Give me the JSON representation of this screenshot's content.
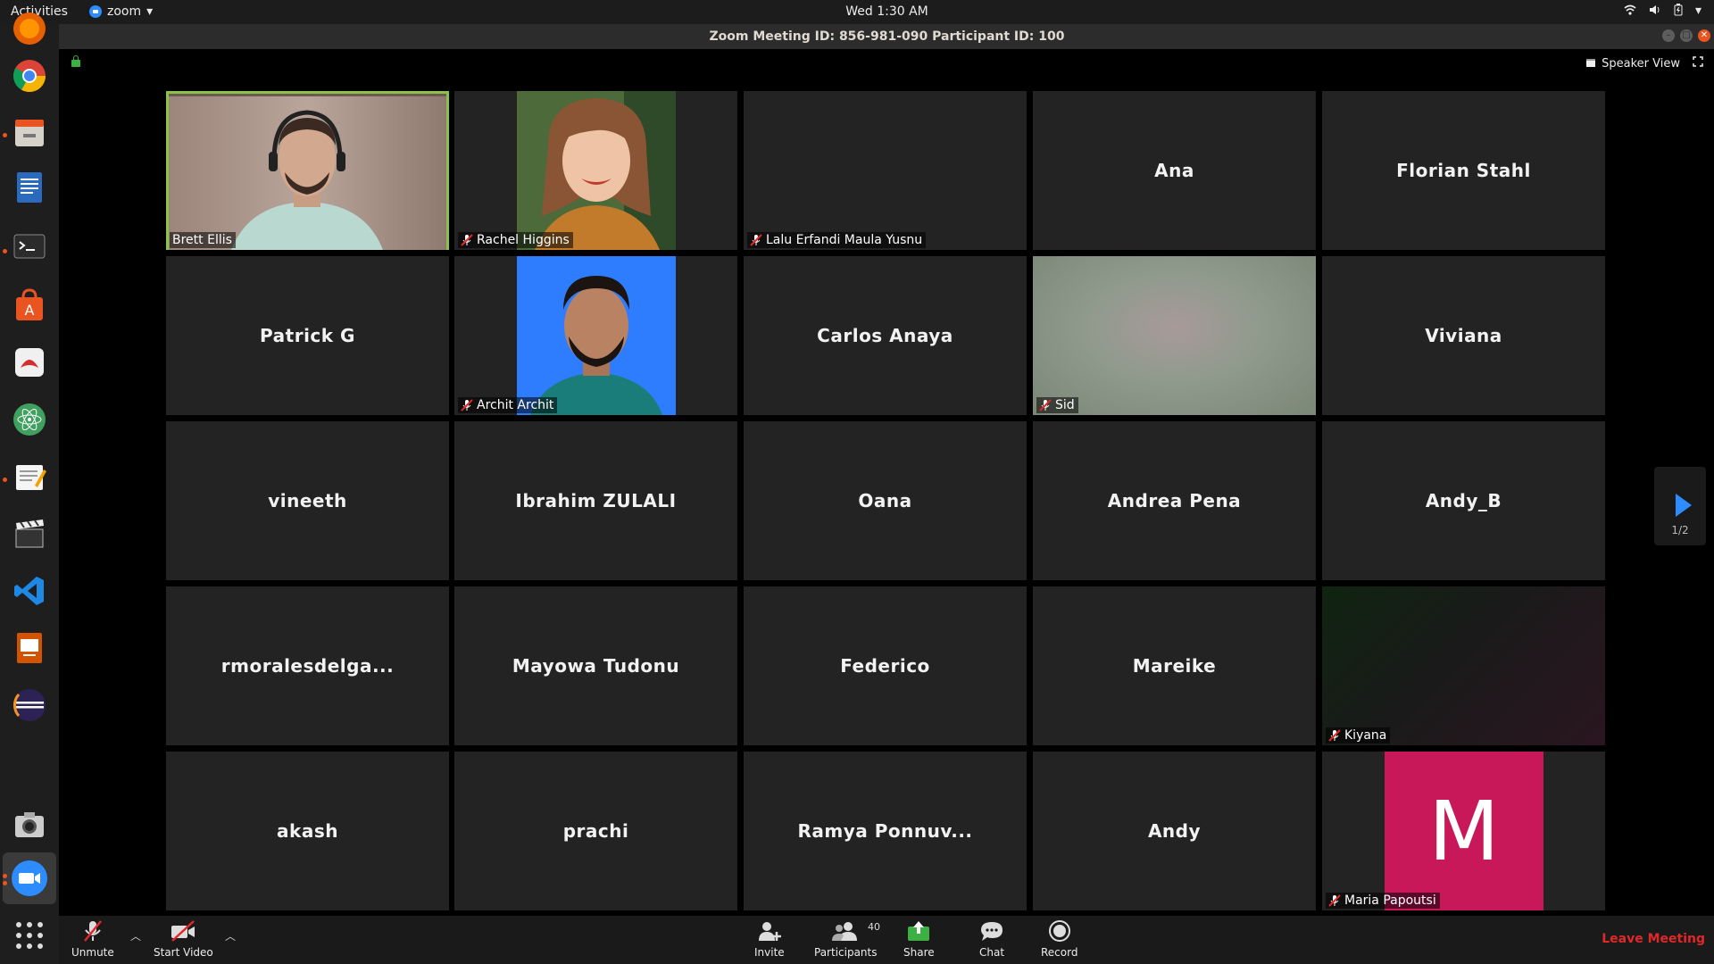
{
  "system_bar": {
    "activities": "Activities",
    "app_name": "zoom",
    "clock": "Wed  1:30 AM"
  },
  "window": {
    "title": "Zoom Meeting ID: 856-981-090 Participant ID: 100"
  },
  "view": {
    "speaker_view": "Speaker View",
    "page_indicator": "1/2"
  },
  "tiles": [
    {
      "name": "Brett Ellis",
      "video": true,
      "muted": false,
      "active_speaker": true
    },
    {
      "name": "Rachel Higgins",
      "video": true,
      "muted": true
    },
    {
      "name": "Lalu Erfandi Maula Yusnu",
      "video": false,
      "muted": true,
      "show_label": true
    },
    {
      "name": "Ana",
      "video": false
    },
    {
      "name": "Florian Stahl",
      "video": false
    },
    {
      "name": "Patrick G",
      "video": false
    },
    {
      "name": "Archit Archit",
      "video": true,
      "muted": true
    },
    {
      "name": "Carlos Anaya",
      "video": false
    },
    {
      "name": "Sid",
      "video": true,
      "muted": true
    },
    {
      "name": "Viviana",
      "video": false
    },
    {
      "name": "vineeth",
      "video": false
    },
    {
      "name": "Ibrahim ZULALI",
      "video": false
    },
    {
      "name": "Oana",
      "video": false
    },
    {
      "name": "Andrea Pena",
      "video": false
    },
    {
      "name": "Andy_B",
      "video": false
    },
    {
      "name": "rmoralesdelga...",
      "video": false
    },
    {
      "name": "Mayowa Tudonu",
      "video": false
    },
    {
      "name": "Federico",
      "video": false
    },
    {
      "name": "Mareike",
      "video": false
    },
    {
      "name": "Kiyana",
      "video": true,
      "muted": true
    },
    {
      "name": "akash",
      "video": false
    },
    {
      "name": "prachi",
      "video": false
    },
    {
      "name": "Ramya Ponnuv...",
      "video": false
    },
    {
      "name": "Andy",
      "video": false
    },
    {
      "name": "Maria Papoutsi",
      "video": true,
      "muted": true,
      "avatar_letter": "M"
    }
  ],
  "toolbar": {
    "unmute": "Unmute",
    "start_video": "Start Video",
    "invite": "Invite",
    "participants": "Participants",
    "participants_count": "40",
    "share": "Share",
    "chat": "Chat",
    "record": "Record",
    "leave": "Leave Meeting"
  },
  "colors": {
    "accent_blue": "#2d8cff",
    "active_speaker_border": "#8bc34a",
    "leave_red": "#e02828",
    "share_green": "#3cb043",
    "avatar_pink": "#c8185a"
  }
}
